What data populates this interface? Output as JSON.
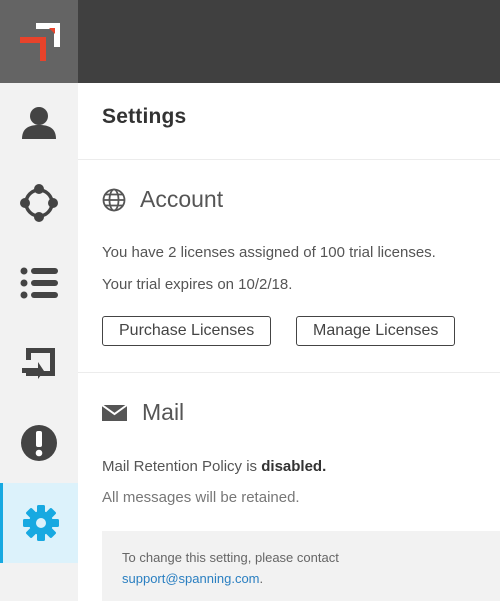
{
  "nav": [
    {
      "name": "user-icon"
    },
    {
      "name": "network-icon"
    },
    {
      "name": "list-icon"
    },
    {
      "name": "restore-icon"
    },
    {
      "name": "alert-icon"
    },
    {
      "name": "gear-icon",
      "active": true
    }
  ],
  "colors": {
    "sidebar_bg": "#f2f2f2",
    "logo_tile": "#646464",
    "topbar": "#404040",
    "active_accent": "#17a9e1",
    "active_bg": "#dcf2fb",
    "logo_red": "#e8432b",
    "link": "#2a7fc1"
  },
  "page_title": "Settings",
  "account": {
    "icon": "globe-icon",
    "title": "Account",
    "licenses_text": "You have 2 licenses assigned of 100 trial licenses.",
    "trial_text": "Your trial expires on 10/2/18.",
    "purchase_label": "Purchase Licenses",
    "manage_label": "Manage Licenses"
  },
  "mail": {
    "icon": "envelope-icon",
    "title": "Mail",
    "policy_prefix": "Mail Retention Policy is ",
    "policy_status": "disabled.",
    "retained_text": "All messages will be retained.",
    "notice_text": "To change this setting, please contact",
    "support_link": "support@spanning.com",
    "support_suffix": "."
  }
}
